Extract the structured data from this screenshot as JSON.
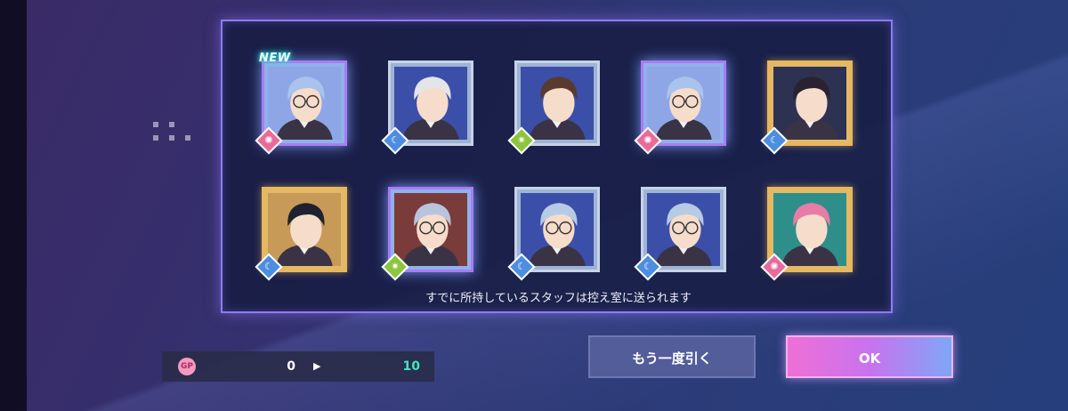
{
  "results": {
    "cards": [
      {
        "rarity": "ssr",
        "attribute": "sun",
        "is_new": true,
        "hair": "#a9c3ec",
        "bg": "#8fa6e6",
        "glasses": true
      },
      {
        "rarity": "sr",
        "attribute": "moon",
        "is_new": false,
        "hair": "#e4e4ea",
        "bg": "#3b4fa8",
        "glasses": false
      },
      {
        "rarity": "sr",
        "attribute": "star",
        "is_new": false,
        "hair": "#5a3a2e",
        "bg": "#3b4fa8",
        "glasses": false
      },
      {
        "rarity": "ssr",
        "attribute": "sun",
        "is_new": false,
        "hair": "#a9c3ec",
        "bg": "#8fa6e6",
        "glasses": true
      },
      {
        "rarity": "ur",
        "attribute": "moon",
        "is_new": false,
        "hair": "#2a2230",
        "bg": "#2d3252",
        "glasses": false
      },
      {
        "rarity": "ur",
        "attribute": "moon",
        "is_new": false,
        "hair": "#1e2230",
        "bg": "#c79a57",
        "glasses": false
      },
      {
        "rarity": "ssr",
        "attribute": "star",
        "is_new": false,
        "hair": "#b8c4dd",
        "bg": "#7a3b3b",
        "glasses": true
      },
      {
        "rarity": "sr",
        "attribute": "moon",
        "is_new": false,
        "hair": "#b6cbe4",
        "bg": "#3b4fa8",
        "glasses": true
      },
      {
        "rarity": "sr",
        "attribute": "moon",
        "is_new": false,
        "hair": "#b6cbe4",
        "bg": "#3b4fa8",
        "glasses": true
      },
      {
        "rarity": "ur",
        "attribute": "sun",
        "is_new": false,
        "hair": "#e77ca6",
        "bg": "#2e8f8a",
        "glasses": false
      }
    ],
    "new_label": "NEW",
    "note": "すでに所持しているスタッフは控え室に送られます"
  },
  "gp": {
    "icon_label": "GP",
    "from": "0",
    "to": "10",
    "arrow": "▶"
  },
  "buttons": {
    "again": "もう一度引く",
    "ok": "OK"
  },
  "attribute_glyphs": {
    "moon": "☾",
    "sun": "✺",
    "star": "✷"
  },
  "colors": {
    "accent_green": "#3ee6c0",
    "new_glow": "#1ce6d5",
    "frame_ur": "#e8b65c",
    "frame_ssr": "#a97cf4",
    "frame_sr": "#c6d3e8"
  }
}
